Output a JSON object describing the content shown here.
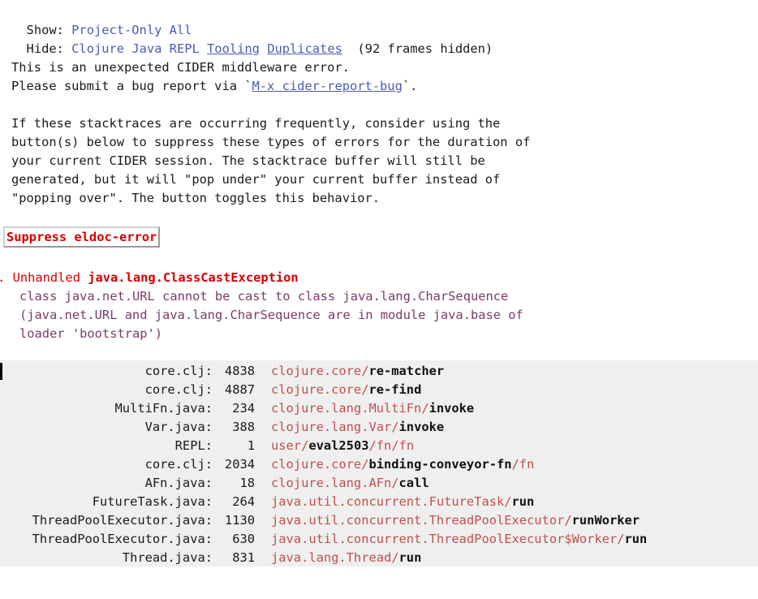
{
  "show": {
    "label": "Show: ",
    "options": [
      "Project-Only",
      "All"
    ]
  },
  "hide": {
    "label": "Hide: ",
    "options": [
      "Clojure",
      "Java",
      "REPL",
      "Tooling",
      "Duplicates"
    ],
    "active": [
      "Tooling",
      "Duplicates"
    ],
    "hidden_count": "(92 frames hidden)"
  },
  "notice": {
    "line1": "This is an unexpected CIDER middleware error.",
    "line2_prefix": "Please submit a bug report via `",
    "line2_link": "M-x cider-report-bug",
    "line2_suffix": "`.",
    "para": [
      "If these stacktraces are occurring frequently, consider using the",
      "button(s) below to suppress these types of errors for the duration of",
      "your current CIDER session. The stacktrace buffer will still be",
      "generated, but it will \"pop under\" your current buffer instead of",
      "\"popping over\". The button toggles this behavior."
    ]
  },
  "suppress_button": "Suppress eldoc-error",
  "error": {
    "number": ".",
    "unhandled": "Unhandled ",
    "exception": "java.lang.ClassCastException",
    "message": [
      "class java.net.URL cannot be cast to class java.lang.CharSequence",
      "(java.net.URL and java.lang.CharSequence are in module java.base of",
      "loader 'bootstrap')"
    ]
  },
  "frames": [
    {
      "file": "core.clj:",
      "line": "4838",
      "ns": "clojure.core/",
      "fn": "re-matcher",
      "tail": ""
    },
    {
      "file": "core.clj:",
      "line": "4887",
      "ns": "clojure.core/",
      "fn": "re-find",
      "tail": ""
    },
    {
      "file": "MultiFn.java:",
      "line": "234",
      "ns": "clojure.lang.MultiFn/",
      "fn": "invoke",
      "tail": ""
    },
    {
      "file": "Var.java:",
      "line": "388",
      "ns": "clojure.lang.Var/",
      "fn": "invoke",
      "tail": ""
    },
    {
      "file": "REPL:",
      "line": "1",
      "ns": "user/",
      "fn": "eval2503",
      "tail": "/fn/fn"
    },
    {
      "file": "core.clj:",
      "line": "2034",
      "ns": "clojure.core/",
      "fn": "binding-conveyor-fn",
      "tail": "/fn"
    },
    {
      "file": "AFn.java:",
      "line": "18",
      "ns": "clojure.lang.AFn/",
      "fn": "call",
      "tail": ""
    },
    {
      "file": "FutureTask.java:",
      "line": "264",
      "ns": "java.util.concurrent.FutureTask/",
      "fn": "run",
      "tail": ""
    },
    {
      "file": "ThreadPoolExecutor.java:",
      "line": "1130",
      "ns": "java.util.concurrent.ThreadPoolExecutor/",
      "fn": "runWorker",
      "tail": ""
    },
    {
      "file": "ThreadPoolExecutor.java:",
      "line": "630",
      "ns": "java.util.concurrent.ThreadPoolExecutor$Worker/",
      "fn": "run",
      "tail": ""
    },
    {
      "file": "Thread.java:",
      "line": "831",
      "ns": "java.lang.Thread/",
      "fn": "run",
      "tail": ""
    }
  ],
  "colors": {
    "filter_link": "#4a5bb8",
    "error_red": "#d40000",
    "error_message": "#7a3a6a",
    "frame_ns": "#c0504d",
    "stack_background": "#efefef"
  }
}
